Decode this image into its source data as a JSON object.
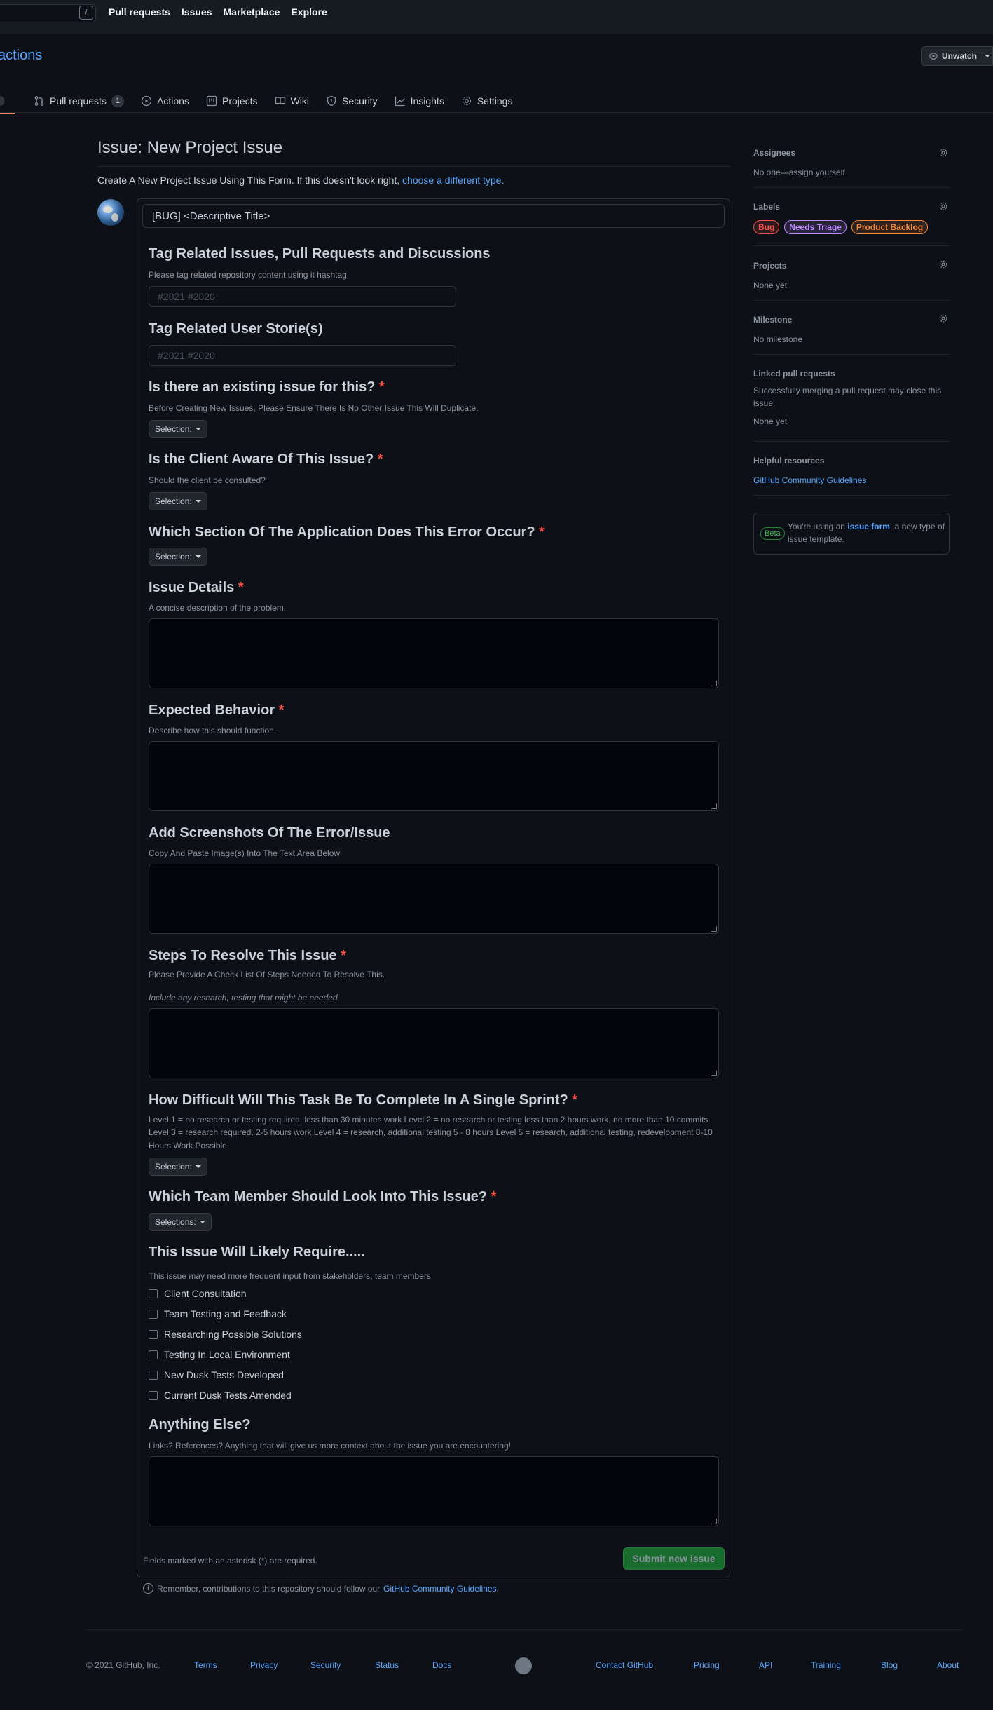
{
  "header": {
    "search_key": "/",
    "nav": [
      "Pull requests",
      "Issues",
      "Marketplace",
      "Explore"
    ]
  },
  "repo": {
    "name_fragment": "actions",
    "watch_label": "Unwatch",
    "tabs": {
      "pull_requests": "Pull requests",
      "pull_requests_count": "1",
      "actions": "Actions",
      "projects": "Projects",
      "wiki": "Wiki",
      "security": "Security",
      "insights": "Insights",
      "settings": "Settings"
    }
  },
  "page": {
    "title": "Issue: New Project Issue",
    "intro": "Create A New Project Issue Using This Form. If this doesn't look right,",
    "intro_link": "choose a different type."
  },
  "form": {
    "title_value": "[BUG] <Descriptive Title>",
    "required_mark": "*",
    "tag_issues": {
      "heading": "Tag Related Issues, Pull Requests and Discussions",
      "description": "Please tag related repository content using it hashtag",
      "placeholder": "#2021 #2020"
    },
    "tag_stories": {
      "heading": "Tag Related User Storie(s)",
      "placeholder": "#2021 #2020"
    },
    "existing_issue": {
      "heading": "Is there an existing issue for this?",
      "description": "Before Creating New Issues, Please Ensure There Is No Other Issue This Will Duplicate.",
      "select": "Selection:"
    },
    "client_aware": {
      "heading": "Is the Client Aware Of This Issue?",
      "description": "Should the client be consulted?",
      "select": "Selection:"
    },
    "section": {
      "heading": "Which Section Of The Application Does This Error Occur?",
      "select": "Selection:"
    },
    "details": {
      "heading": "Issue Details",
      "description": "A concise description of the problem."
    },
    "expected": {
      "heading": "Expected Behavior",
      "description": "Describe how this should function."
    },
    "screenshots": {
      "heading": "Add Screenshots Of The Error/Issue",
      "description": "Copy And Paste Image(s) Into The Text Area Below"
    },
    "steps": {
      "heading": "Steps To Resolve This Issue",
      "description": "Please Provide A Check List Of Steps Needed To Resolve This.",
      "note": "Include any research, testing that might be needed"
    },
    "difficulty": {
      "heading": "How Difficult Will This Task Be To Complete In A Single Sprint?",
      "description_line1": "Level 1 = no research or testing required, less than 30 minutes work Level 2 = no research or testing less than 2 hours work, no more than 10 commits",
      "description_line2": "Level 3 = research required, 2-5 hours work Level 4 = research, additional testing 5 - 8 hours Level 5 = research, additional testing, redevelopment 8-10",
      "description_line3": "Hours Work Possible",
      "select": "Selection:"
    },
    "team_member": {
      "heading": "Which Team Member Should Look Into This Issue?",
      "select": "Selections:"
    },
    "require": {
      "heading": "This Issue Will Likely Require.....",
      "description": "This issue may need more frequent input from stakeholders, team members",
      "options": [
        "Client Consultation",
        "Team Testing and Feedback",
        "Researching Possible Solutions",
        "Testing In Local Environment",
        "New Dusk Tests Developed",
        "Current Dusk Tests Amended"
      ]
    },
    "anything_else": {
      "heading": "Anything Else?",
      "description": "Links? References? Anything that will give us more context about the issue you are encountering!"
    },
    "required_note": "Fields marked with an asterisk (*) are required.",
    "submit_label": "Submit new issue",
    "remember_text": "Remember, contributions to this repository should follow our",
    "remember_link": "GitHub Community Guidelines",
    "remember_end": "."
  },
  "sidebar": {
    "assignees": {
      "heading": "Assignees",
      "value": "No one—assign yourself"
    },
    "labels": {
      "heading": "Labels",
      "items": [
        {
          "name": "Bug",
          "color": "#f85149"
        },
        {
          "name": "Needs Triage",
          "color": "#bc8cff"
        },
        {
          "name": "Product Backlog",
          "color": "#f0883e"
        }
      ]
    },
    "projects": {
      "heading": "Projects",
      "value": "None yet"
    },
    "milestone": {
      "heading": "Milestone",
      "value": "No milestone"
    },
    "linked_prs": {
      "heading": "Linked pull requests",
      "description_line1": "Successfully merging a pull request may close this",
      "description_line2": "issue.",
      "value": "None yet"
    },
    "helpful": {
      "heading": "Helpful resources",
      "link": "GitHub Community Guidelines"
    },
    "beta": {
      "pill": "Beta",
      "text_before": "You're using an",
      "link": "issue form",
      "text_after": ", a new type of issue template."
    }
  },
  "footer": {
    "copyright": "© 2021 GitHub, Inc.",
    "left_links": [
      "Terms",
      "Privacy",
      "Security",
      "Status",
      "Docs"
    ],
    "right_links": [
      "Contact GitHub",
      "Pricing",
      "API",
      "Training",
      "Blog",
      "About"
    ]
  },
  "colors": {
    "background": "#0d1117",
    "link": "#58a6ff",
    "required": "#f85149",
    "submit": "#196c2e"
  }
}
